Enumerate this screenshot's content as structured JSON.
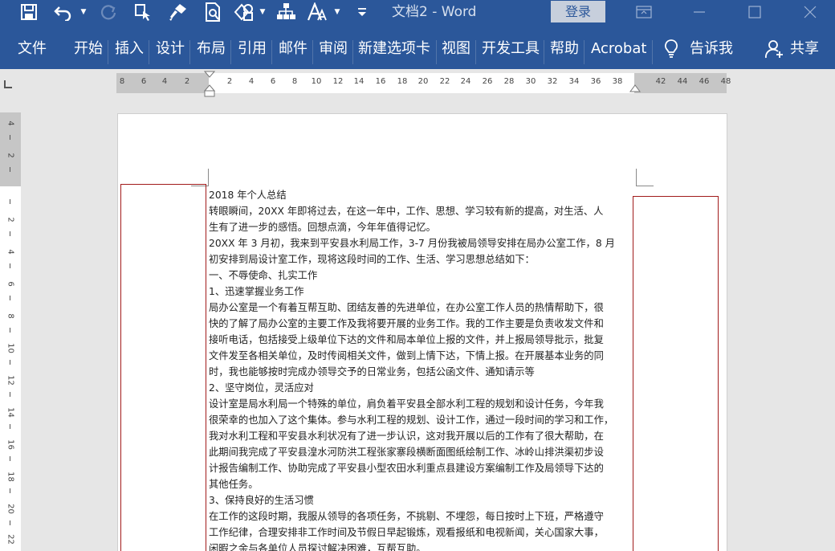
{
  "title_bar": {
    "document_title": "文档2  -  Word",
    "login_label": "登录",
    "quick_access": [
      "save-icon",
      "undo-icon",
      "redo-icon",
      "touch-mode-icon",
      "format-painter-icon",
      "print-preview-icon",
      "shapes-icon",
      "smartart-icon",
      "text-effects-icon",
      "customize-toolbar-icon"
    ],
    "window_controls": [
      "ribbon-display-icon",
      "minimize-icon",
      "maximize-icon",
      "close-icon"
    ]
  },
  "ribbon": {
    "tabs": [
      "文件",
      "开始",
      "插入",
      "设计",
      "布局",
      "引用",
      "邮件",
      "审阅",
      "新建选项卡",
      "视图",
      "开发工具",
      "帮助",
      "Acrobat"
    ],
    "tell_me": "告诉我",
    "share": "共享"
  },
  "rulers": {
    "horizontal_labels": [
      "8",
      "6",
      "4",
      "2",
      "2",
      "4",
      "6",
      "8",
      "10",
      "12",
      "14",
      "16",
      "18",
      "20",
      "22",
      "24",
      "26",
      "28",
      "30",
      "32",
      "34",
      "36",
      "38",
      "42",
      "44",
      "46",
      "48"
    ],
    "vertical_labels": [
      "4",
      "2",
      "2",
      "4",
      "6",
      "8",
      "10",
      "12",
      "14",
      "16",
      "18",
      "20",
      "22"
    ]
  },
  "document": {
    "lines": [
      "2018 年个人总结",
      "转眼瞬间，20XX 年即将过去，在这一年中，工作、思想、学习较有新的提高，对生活、人",
      "生有了进一步的感悟。回想点滴，今年年值得记忆。",
      "20XX 年 3 月初，我来到平安县水利局工作，3-7 月份我被局领导安排在局办公室工作，8 月",
      "初安排到局设计室工作，现将这段时间的工作、生活、学习思想总结如下：",
      "一、不辱使命、扎实工作",
      "1、迅速掌握业务工作",
      "局办公室是一个有着互帮互助、团结友善的先进单位，在办公室工作人员的热情帮助下，很",
      "快的了解了局办公室的主要工作及我将要开展的业务工作。我的工作主要是负责收发文件和",
      "接听电话，包括接受上级单位下达的文件和局本单位上报的文件，并上报局领导批示，批复",
      "文件发至各相关单位，及时传阅相关文件，做到上情下达，下情上报。在开展基本业务的同",
      "时，我也能够按时完成办领导交予的日常业务，包括公函文件、通知请示等",
      "2、坚守岗位，灵活应对",
      "设计室是局水利局一个特殊的单位，肩负着平安县全部水利工程的规划和设计任务，今年我",
      "很荣幸的也加入了这个集体。参与水利工程的规划、设计工作，通过一段时间的学习和工作，",
      "我对水利工程和平安县水利状况有了进一步认识，这对我开展以后的工作有了很大帮助，在",
      "此期间我完成了平安县湟水河防洪工程张家寨段横断面图纸绘制工作、冰岭山排洪渠初步设",
      "计报告编制工作、协助完成了平安县小型农田水利重点县建设方案编制工作及局领导下达的",
      "其他任务。",
      "3、保持良好的生活习惯",
      "在工作的这段时期，我服从领导的各项任务，不挑剔、不埋怨，每日按时上下班，严格遵守",
      "工作纪律，合理安排非工作时间及节假日早起锻炼，观看报纸和电视新闻，关心国家大事，",
      "闲暇之余与各单位人员探讨解决困难，互帮互助。"
    ]
  },
  "colors": {
    "ribbon_blue": "#2b579a",
    "text_box_border": "#a11b1b"
  }
}
